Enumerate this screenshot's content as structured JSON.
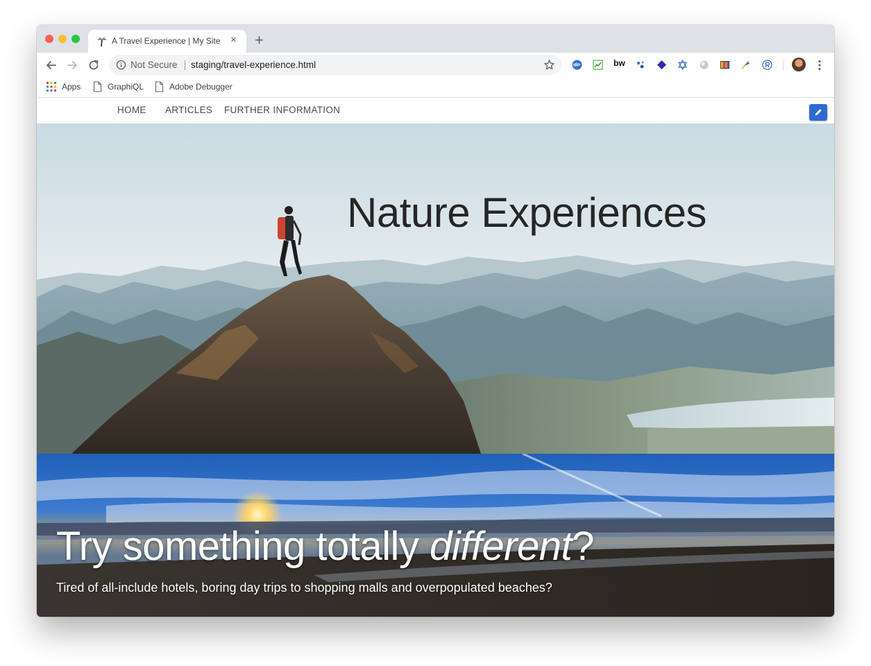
{
  "window": {
    "traffic_lights": [
      "close",
      "minimize",
      "zoom"
    ]
  },
  "tab": {
    "title": "A Travel Experience | My Site",
    "close_glyph": "×",
    "favicon": "palm-tree-icon"
  },
  "new_tab_glyph": "+",
  "toolbar": {
    "security_label": "Not Secure",
    "url": "staging/travel-experience.html",
    "extension_text": "bw",
    "icons": [
      "back-arrow-icon",
      "forward-arrow-icon",
      "reload-icon",
      "info-icon",
      "star-icon",
      "kebab-menu-icon"
    ]
  },
  "bookmarks": [
    {
      "label": "Apps",
      "icon": "apps-grid-icon"
    },
    {
      "label": "GraphiQL",
      "icon": "page-icon"
    },
    {
      "label": "Adobe Debugger",
      "icon": "page-icon"
    }
  ],
  "site_nav": {
    "items": [
      "HOME",
      "ARTICLES",
      "FURTHER INFORMATION"
    ]
  },
  "hero": {
    "title": "Nature Experiences"
  },
  "banner": {
    "title_main": "Try something totally ",
    "title_emphasis": "different",
    "title_end": "?",
    "subtitle": "Tired of all-include hotels, boring day trips to shopping malls and overpopulated beaches?"
  },
  "colors": {
    "edit_button": "#2d6bd1",
    "tab_strip": "#dee1e6",
    "omnibox": "#f1f3f4"
  }
}
